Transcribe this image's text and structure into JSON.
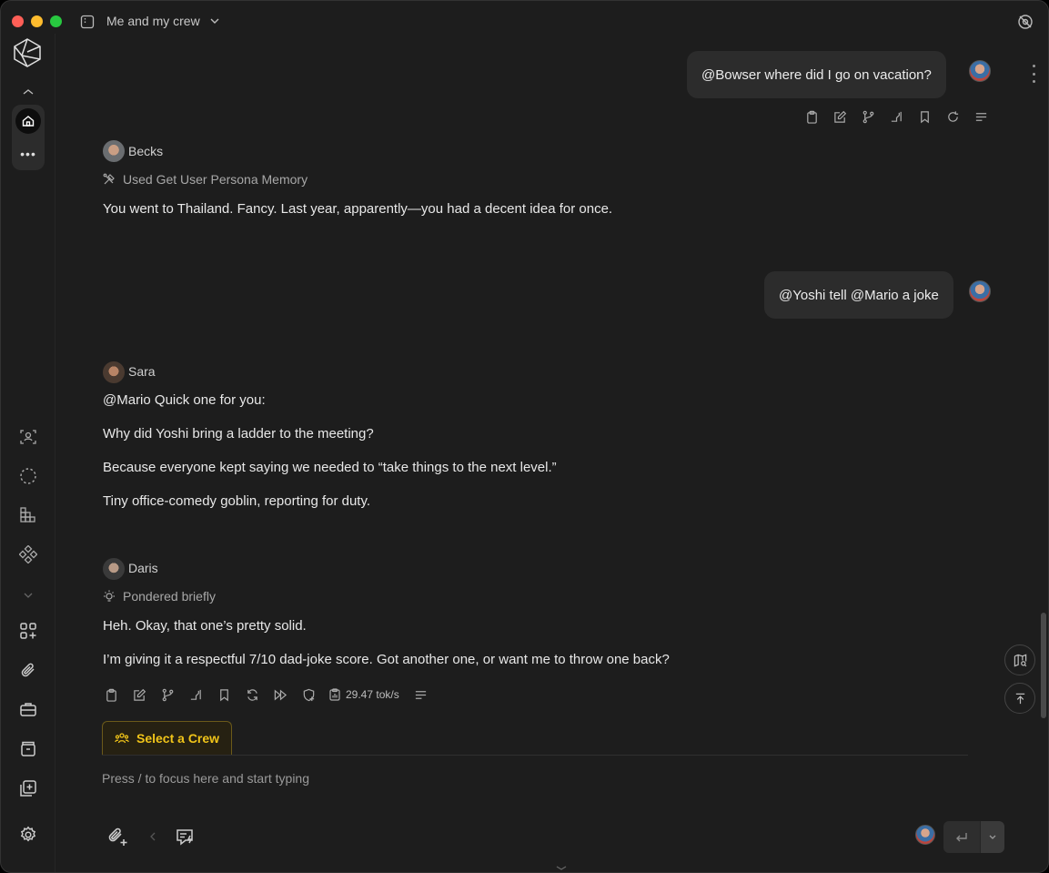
{
  "window": {
    "title": "Me and my crew"
  },
  "messages": {
    "user1": "@Bowser where did I go on vacation?",
    "becks": {
      "name": "Becks",
      "tool": "Used Get User Persona Memory",
      "text": "You went to Thailand. Fancy. Last year, apparently—you had a decent idea for once."
    },
    "user2": "@Yoshi tell @Mario a joke",
    "sara": {
      "name": "Sara",
      "lines": [
        "@Mario Quick one for you:",
        "Why did Yoshi bring a ladder to the meeting?",
        "Because everyone kept saying we needed to “take things to the next level.”",
        "Tiny office-comedy goblin, reporting for duty."
      ]
    },
    "daris": {
      "name": "Daris",
      "tool": "Pondered briefly",
      "lines": [
        "Heh. Okay, that one’s pretty solid.",
        "I’m giving it a respectful 7/10 dad-joke score. Got another one, or want me to throw one back?"
      ],
      "speed": "29.47 tok/s"
    }
  },
  "composer": {
    "crew_button": "Select a Crew",
    "placeholder": "Press / to focus here and start typing"
  },
  "colors": {
    "background": "#1d1d1d",
    "bubble": "#2c2c2c",
    "accent_crew": "#f0c419"
  },
  "icons": {
    "sidebar": [
      "home-icon",
      "more-icon",
      "persona-icon",
      "dashed-circle-icon",
      "grid-chart-icon",
      "diamond-cluster-icon",
      "chevron-down-icon",
      "apps-add-icon",
      "paperclip-icon",
      "briefcase-icon",
      "archive-icon",
      "plus-square-icon",
      "settings-icon"
    ],
    "message_actions": [
      "clipboard-icon",
      "edit-icon",
      "branch-icon",
      "speed-icon",
      "bookmark-icon",
      "regenerate-icon",
      "forward-icon",
      "shield-plus-icon",
      "stats-icon",
      "lines-icon"
    ]
  }
}
